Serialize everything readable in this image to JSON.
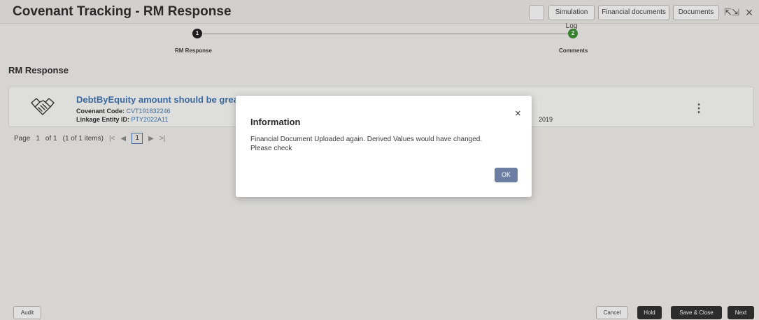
{
  "header": {
    "title": "Covenant Tracking - RM Response",
    "buttons": {
      "simulation_log": "Simulation Log",
      "financial_documents": "Financial documents",
      "documents": "Documents"
    },
    "icons": {
      "expand": "expand-icon",
      "close": "close-icon"
    }
  },
  "stepper": {
    "steps": [
      {
        "number": "1",
        "label": "RM Response",
        "state": "current"
      },
      {
        "number": "2",
        "label": "Comments",
        "state": "next"
      }
    ]
  },
  "section_title": "RM Response",
  "card": {
    "title": "DebtByEquity amount should be greater",
    "covenant_code_label": "Covenant Code:",
    "covenant_code": "CVT191832246",
    "linkage_entity_label": "Linkage Entity ID:",
    "linkage_entity": "PTY2022A11",
    "date_fragment": "2019",
    "icon": "handshake-icon"
  },
  "pager": {
    "page_label": "Page",
    "page": "1",
    "of_label": "of 1",
    "items": "(1 of 1 items)",
    "current": "1"
  },
  "dialog": {
    "title": "Information",
    "message": "Financial Document Uploaded again. Derived Values would have changed. Please check",
    "ok": "OK"
  },
  "footer": {
    "audit": "Audit",
    "cancel": "Cancel",
    "hold": "Hold",
    "save_close": "Save & Close",
    "next": "Next"
  },
  "colors": {
    "accent_blue": "#3d74b0",
    "step_done": "#1d1d1d",
    "step_next": "#3c8d2f",
    "primary_button": "#2d2d2d",
    "ok_button": "#6c7fa2"
  }
}
